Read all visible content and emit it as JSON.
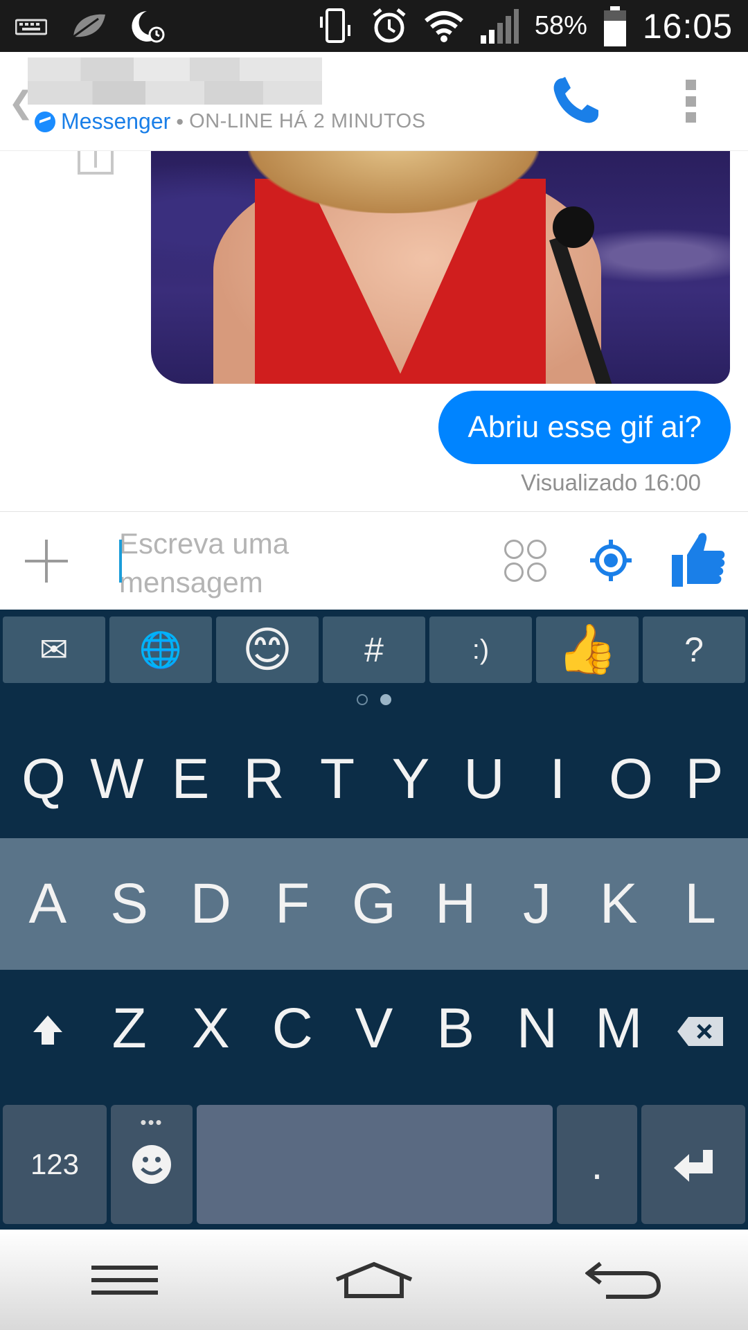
{
  "status_bar": {
    "battery_percent": "58%",
    "time": "16:05",
    "icons": [
      "keyboard-icon",
      "leaf-icon",
      "night-mode-icon",
      "vibrate-icon",
      "alarm-icon",
      "wifi-icon",
      "signal-icon",
      "battery-icon"
    ]
  },
  "header": {
    "app_name": "Messenger",
    "separator": "•",
    "online_status": "ON-LINE HÁ 2 MINUTOS",
    "back_glyph": "❮"
  },
  "chat": {
    "messages": [
      {
        "type": "gif",
        "sender": "other"
      },
      {
        "type": "text",
        "sender": "me",
        "text": "Abriu esse gif ai?"
      }
    ],
    "seen_status": "Visualizado 16:00"
  },
  "composer": {
    "placeholder": "Escreva uma mensagem",
    "value": ""
  },
  "keyboard": {
    "suggestion_keys": [
      "✉",
      "🌐",
      "😊",
      "#",
      ":)",
      "👍",
      "?"
    ],
    "rows": [
      [
        "Q",
        "W",
        "E",
        "R",
        "T",
        "Y",
        "U",
        "I",
        "O",
        "P"
      ],
      [
        "A",
        "S",
        "D",
        "F",
        "G",
        "H",
        "J",
        "K",
        "L"
      ],
      [
        "Z",
        "X",
        "C",
        "V",
        "B",
        "N",
        "M"
      ]
    ],
    "numbers_key": "123",
    "emoji_more": "•••",
    "period_key": ".",
    "page_count": 2,
    "active_page": 2
  },
  "colors": {
    "accent": "#0084ff",
    "keyboard_bg": "#0c2d47",
    "keyboard_highlight_row": "#5a7489"
  }
}
